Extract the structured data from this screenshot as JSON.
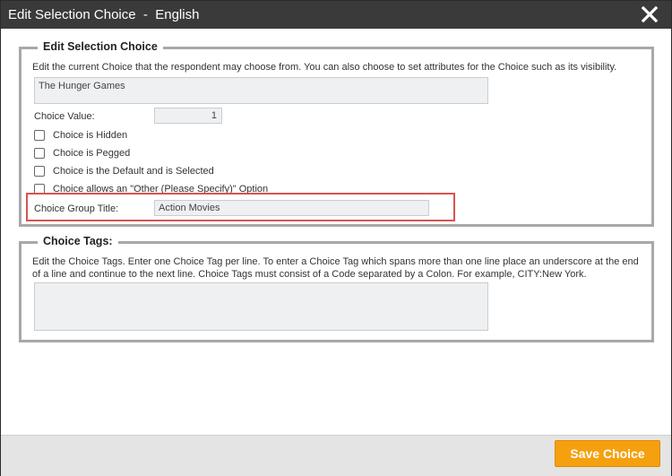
{
  "window": {
    "title": "Edit Selection Choice  -  English"
  },
  "section_choice": {
    "legend": "Edit Selection Choice",
    "description": "Edit the current Choice that the respondent may choose from. You can also choose to set attributes for the Choice such as its visibility.",
    "choice_text": "The Hunger Games",
    "value_label": "Choice Value:",
    "value": "1",
    "checkboxes": [
      {
        "label": "Choice is Hidden",
        "checked": false
      },
      {
        "label": "Choice is Pegged",
        "checked": false
      },
      {
        "label": "Choice is the Default and is Selected",
        "checked": false
      },
      {
        "label": "Choice allows an \"Other (Please Specify)\" Option",
        "checked": false
      }
    ],
    "group_title_label": "Choice Group Title:",
    "group_title_value": "Action Movies"
  },
  "section_tags": {
    "legend": "Choice Tags:",
    "description": "Edit the Choice Tags. Enter one Choice Tag per line. To enter a Choice Tag which spans more than one line place an underscore at the end of a line and continue to the next line. Choice Tags must consist of a Code separated by a Colon. For example, CITY:New York.",
    "tags_value": ""
  },
  "footer": {
    "save_label": "Save Choice"
  },
  "colors": {
    "titlebar": "#3a3a3a",
    "accent": "#f5a00f",
    "highlight": "#d9534f"
  },
  "icons": {
    "close": "close-icon"
  }
}
